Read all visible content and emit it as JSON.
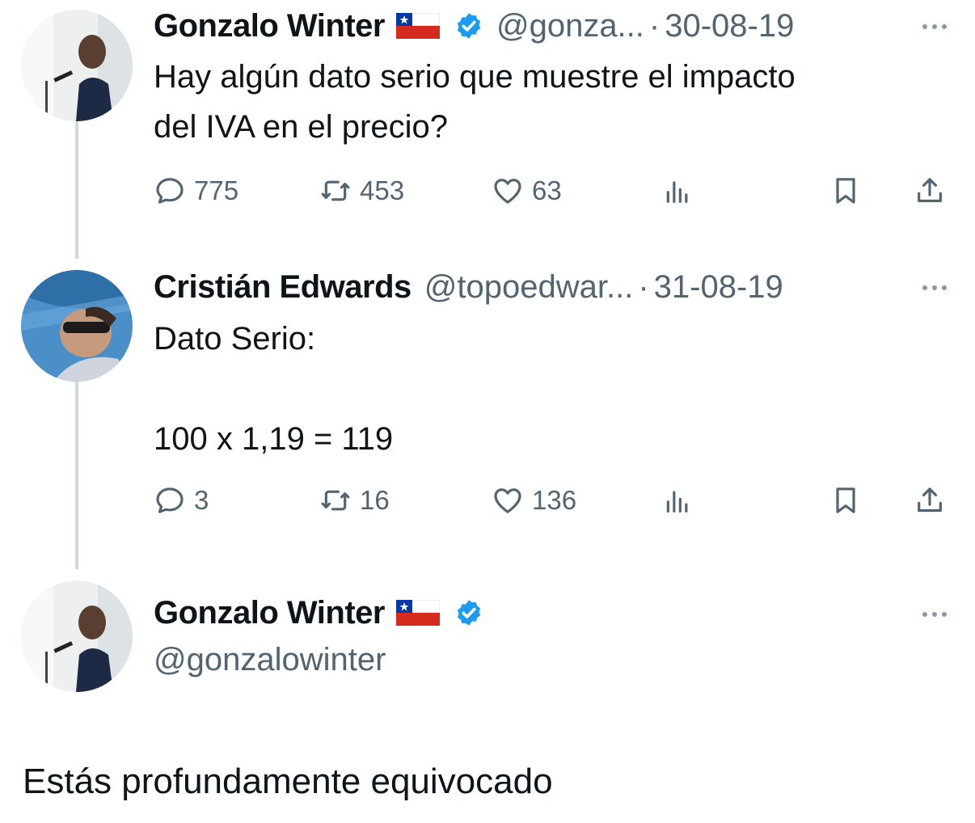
{
  "tweets": [
    {
      "name": "Gonzalo Winter",
      "handle": "@gonza...",
      "separator": "·",
      "date": "30-08-19",
      "text": "Hay algún dato serio que muestre el impacto\ndel IVA en el precio?",
      "replies": "775",
      "retweets": "453",
      "likes": "63"
    },
    {
      "name": "Cristián Edwards",
      "handle": "@topoedwar...",
      "separator": "·",
      "date": "31-08-19",
      "text": "Dato Serio:\n\n100 x 1,19 = 119",
      "replies": "3",
      "retweets": "16",
      "likes": "136"
    },
    {
      "name": "Gonzalo Winter",
      "handle": "@gonzalowinter",
      "text": "Estás profundamente equivocado"
    }
  ],
  "icons": {
    "reply": "speech-bubble-icon",
    "retweet": "retweet-icon",
    "like": "heart-icon",
    "views": "bar-chart-icon",
    "bookmark": "bookmark-icon",
    "share": "share-icon",
    "verified": "verified-badge-icon",
    "flag": "chile-flag-icon",
    "more": "more-dots-icon"
  },
  "colors": {
    "verified": "#1d9bf0",
    "text": "#0f1419",
    "secondary": "#536471",
    "thread_line": "#cfd9de"
  }
}
